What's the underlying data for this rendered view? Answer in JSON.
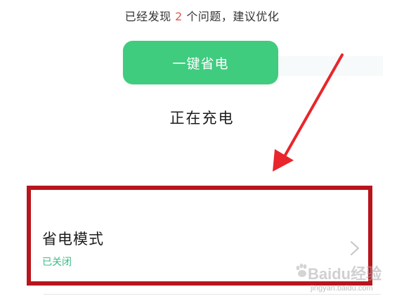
{
  "summary": {
    "prefix": "已经发现 ",
    "issue_count": "2",
    "suffix": " 个问题，建议优化"
  },
  "optimize_button": {
    "label": "一键省电",
    "color": "#3fcc7f"
  },
  "battery_status": {
    "text": "正在充电"
  },
  "power_saving_mode": {
    "title": "省电模式",
    "status": "已关闭",
    "status_color": "#3dbb86",
    "icon": "chevron-right-icon"
  },
  "annotation": {
    "arrow_color": "#e8262b",
    "box_color": "#b8151c"
  },
  "watermark": {
    "brand": "Baidu经验",
    "url": "jingyan.baidu.com"
  }
}
